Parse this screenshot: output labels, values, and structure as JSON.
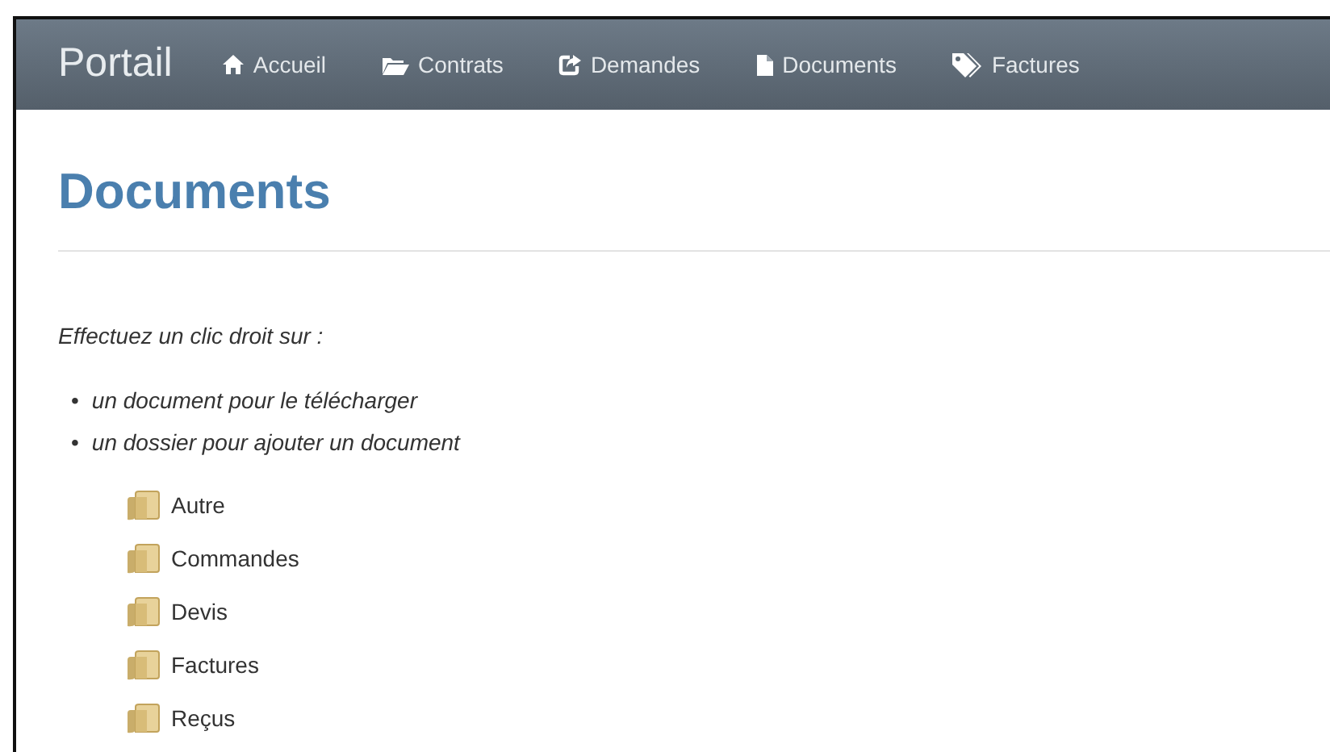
{
  "navbar": {
    "brand": "Portail",
    "items": [
      {
        "label": "Accueil",
        "kind": "home"
      },
      {
        "label": "Contrats",
        "kind": "folder"
      },
      {
        "label": "Demandes",
        "kind": "share"
      },
      {
        "label": "Documents",
        "kind": "file"
      },
      {
        "label": "Factures",
        "kind": "tags"
      }
    ]
  },
  "page": {
    "title": "Documents",
    "instruction": "Effectuez un clic droit sur :",
    "bullets": [
      {
        "marker": "•",
        "text": "un document pour le télécharger"
      },
      {
        "marker": "•",
        "text": "un dossier pour ajouter un document"
      }
    ]
  },
  "folders": [
    "Autre",
    "Commandes",
    "Devis",
    "Factures",
    "Reçus"
  ]
}
